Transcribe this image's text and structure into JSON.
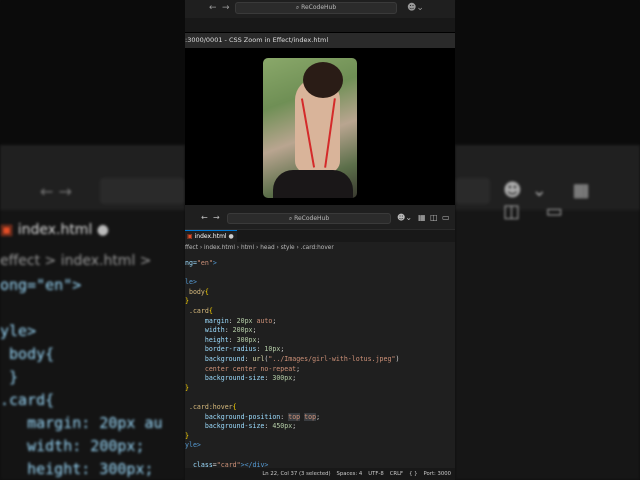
{
  "browser": {
    "address": "ReCodeHub",
    "page_title": ":3000/0001 - CSS Zoom in Effect/index.html"
  },
  "editor": {
    "address": "ReCodeHub",
    "tab": "index.html",
    "breadcrumb": [
      "ffect",
      "index.html",
      "html",
      "head",
      "style",
      ".card:hover"
    ],
    "status": [
      "Ln 22, Col 37 (3 selected)",
      "Spaces: 4",
      "UTF-8",
      "CRLF",
      "{ }",
      "Port: 3000"
    ],
    "code": [
      [
        [
          "ng=",
          "t-attr"
        ],
        [
          "\"en\"",
          "t-str"
        ],
        [
          ">",
          "t-tag"
        ]
      ],
      [],
      [
        [
          "le>",
          "t-tag"
        ]
      ],
      [
        [
          " body",
          "t-sel"
        ],
        [
          "{",
          "t-brace"
        ]
      ],
      [
        [
          "}",
          "t-brace"
        ]
      ],
      [
        [
          " .card",
          "t-sel"
        ],
        [
          "{",
          "t-brace"
        ]
      ],
      [
        [
          "     margin",
          "t-prop"
        ],
        [
          ": ",
          "t-punc"
        ],
        [
          "20px",
          "t-val"
        ],
        [
          " auto",
          "t-kw"
        ],
        [
          ";",
          "t-punc"
        ]
      ],
      [
        [
          "     width",
          "t-prop"
        ],
        [
          ": ",
          "t-punc"
        ],
        [
          "200px",
          "t-val"
        ],
        [
          ";",
          "t-punc"
        ]
      ],
      [
        [
          "     height",
          "t-prop"
        ],
        [
          ": ",
          "t-punc"
        ],
        [
          "300px",
          "t-val"
        ],
        [
          ";",
          "t-punc"
        ]
      ],
      [
        [
          "     border-radius",
          "t-prop"
        ],
        [
          ": ",
          "t-punc"
        ],
        [
          "10px",
          "t-val"
        ],
        [
          ";",
          "t-punc"
        ]
      ],
      [
        [
          "     background",
          "t-prop"
        ],
        [
          ": ",
          "t-punc"
        ],
        [
          "url",
          "t-fn"
        ],
        [
          "(",
          "t-punc"
        ],
        [
          "\"../Images/girl-with-lotus.jpeg\"",
          "t-str"
        ],
        [
          ")",
          "t-punc"
        ]
      ],
      [
        [
          "     center center no-repeat",
          "t-kw"
        ],
        [
          ";",
          "t-punc"
        ]
      ],
      [
        [
          "     background-size",
          "t-prop"
        ],
        [
          ": ",
          "t-punc"
        ],
        [
          "300px",
          "t-val"
        ],
        [
          ";",
          "t-punc"
        ]
      ],
      [
        [
          "}",
          "t-brace"
        ]
      ],
      [],
      [
        [
          " .card:hover",
          "t-sel"
        ],
        [
          "{",
          "t-brace"
        ]
      ],
      [
        [
          "     background-position",
          "t-prop"
        ],
        [
          ": ",
          "t-punc"
        ],
        [
          "top",
          "t-kw hl"
        ],
        [
          " ",
          "t-punc"
        ],
        [
          "top",
          "t-kw hl"
        ],
        [
          ";",
          "t-punc"
        ]
      ],
      [
        [
          "     background-size",
          "t-prop"
        ],
        [
          ": ",
          "t-punc"
        ],
        [
          "450px",
          "t-val"
        ],
        [
          ";",
          "t-punc"
        ]
      ],
      [
        [
          "}",
          "t-brace"
        ]
      ],
      [
        [
          "yle>",
          "t-tag"
        ]
      ],
      [],
      [
        [
          "  class",
          "t-attr"
        ],
        [
          "=",
          "t-punc"
        ],
        [
          "\"card\"",
          "t-str"
        ],
        [
          "></div>",
          "t-tag"
        ]
      ]
    ]
  },
  "side_left": {
    "tab": "index.html",
    "crumb": "effect > index.html >",
    "code": "ong=\"en\">\n\nyle>\n body{\n }\n.card{\n   margin: 20px au\n   width: 200px;\n   height: 300px;"
  },
  "colors": {
    "accent": "#0078d4",
    "background": "#1f1f1f"
  }
}
